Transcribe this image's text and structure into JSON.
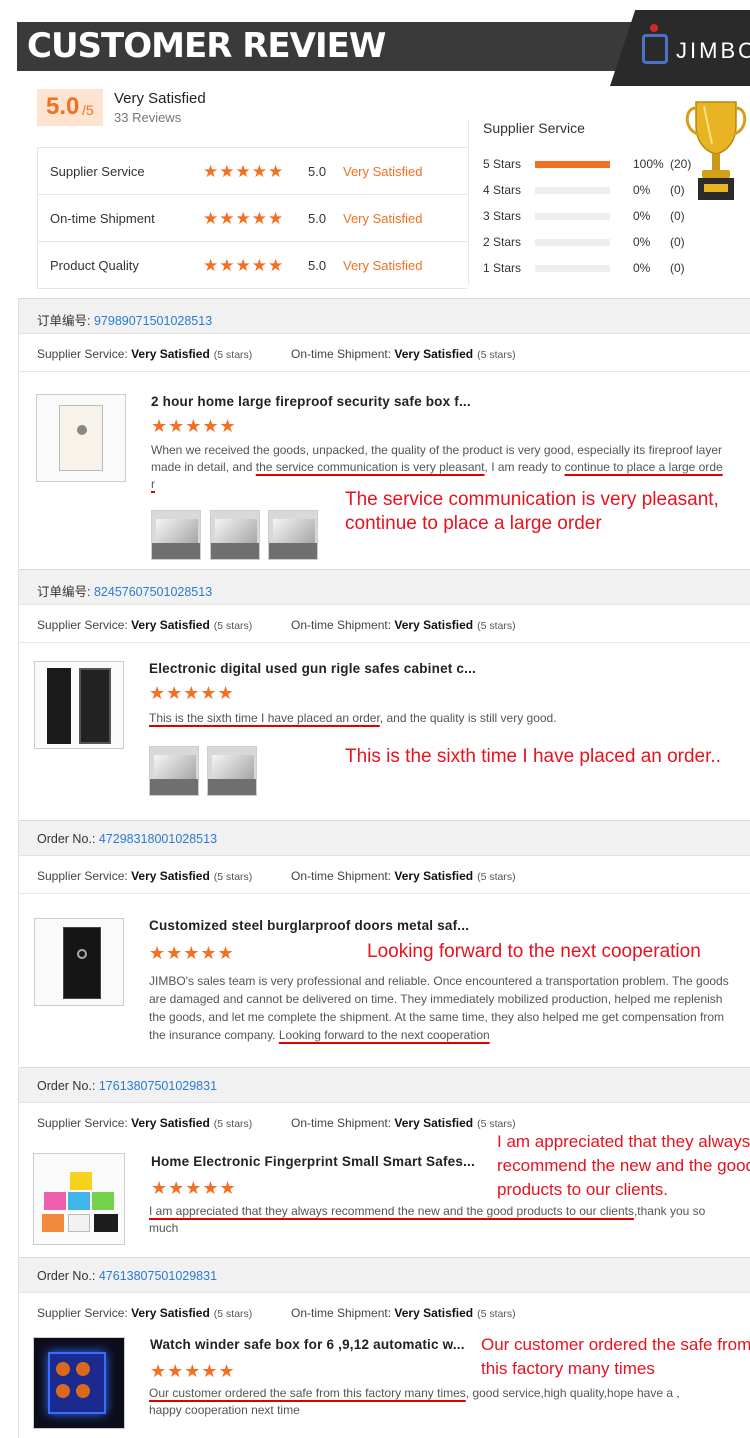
{
  "banner": {
    "title": "CUSTOMER REVIEW",
    "logo_text": "JIMBO"
  },
  "summary": {
    "score": "5.0",
    "score_max": "/5",
    "label": "Very Satisfied",
    "count": "33 Reviews"
  },
  "ratings": [
    {
      "label": "Supplier Service",
      "stars": "★★★★★",
      "score": "5.0",
      "text": "Very Satisfied"
    },
    {
      "label": "On-time Shipment",
      "stars": "★★★★★",
      "score": "5.0",
      "text": "Very Satisfied"
    },
    {
      "label": "Product Quality",
      "stars": "★★★★★",
      "score": "5.0",
      "text": "Very Satisfied"
    }
  ],
  "distribution": {
    "title": "Supplier Service",
    "rows": [
      {
        "label": "5 Stars",
        "fill": 1.0,
        "pct": "100%",
        "count": "(20)"
      },
      {
        "label": "4 Stars",
        "fill": 0,
        "pct": "0%",
        "count": "(0)"
      },
      {
        "label": "3 Stars",
        "fill": 0,
        "pct": "0%",
        "count": "(0)"
      },
      {
        "label": "2 Stars",
        "fill": 0,
        "pct": "0%",
        "count": "(0)"
      },
      {
        "label": "1 Stars",
        "fill": 0,
        "pct": "0%",
        "count": "(0)"
      }
    ]
  },
  "orders": [
    {
      "order_label": "订单编号:",
      "order_no": "97989071501028513",
      "svc_label": "Supplier Service:",
      "svc_value": "Very Satisfied",
      "svc_stars": "(5 stars)",
      "ship_label": "On-time Shipment:",
      "ship_value": "Very Satisfied",
      "ship_stars": "(5 stars)",
      "product_title": "2 hour home large fireproof security safe box f...",
      "stars": "★★★★★",
      "body_1": "When we received the goods, unpacked, the quality of the product is very good, especially its fireproof layer made in detail, and ",
      "body_u1": "the service communication is very pleasant",
      "body_2": ", I am ready to ",
      "body_u2": "continue to place a large orde",
      "body_3": "r",
      "annotation": "The service communication is very pleasant, continue to place a large order"
    },
    {
      "order_label": "订单编号:",
      "order_no": "82457607501028513",
      "svc_label": "Supplier Service:",
      "svc_value": "Very Satisfied",
      "svc_stars": "(5 stars)",
      "ship_label": "On-time Shipment:",
      "ship_value": "Very Satisfied",
      "ship_stars": "(5 stars)",
      "product_title": "Electronic digital used gun rigle safes cabinet c...",
      "stars": "★★★★★",
      "body_u1": "This is the sixth time I have placed an order",
      "body_2": ", and the quality is still very good.",
      "annotation": "This is the sixth time I have placed an order.."
    },
    {
      "order_label": "Order No.:",
      "order_no": "47298318001028513",
      "svc_label": "Supplier Service:",
      "svc_value": "Very Satisfied",
      "svc_stars": "(5 stars)",
      "ship_label": "On-time Shipment:",
      "ship_value": "Very Satisfied",
      "ship_stars": "(5 stars)",
      "product_title": "Customized steel burglarproof doors metal saf...",
      "stars": "★★★★★",
      "body_1": "JIMBO's sales team is very professional and reliable. Once encountered a transportation problem. The goods are damaged and cannot be delivered on time. They immediately mobilized production, helped me replenish the goods, and let me complete the shipment. At the same time, they also helped me get compensation from the insurance company. ",
      "body_u1": "Looking forward to the next cooperation",
      "annotation": "Looking forward to the next cooperation"
    },
    {
      "order_label": "Order No.:",
      "order_no": "17613807501029831",
      "svc_label": "Supplier Service:",
      "svc_value": "Very Satisfied",
      "svc_stars": "(5 stars)",
      "ship_label": "On-time Shipment:",
      "ship_value": "Very Satisfied",
      "ship_stars": "(5 stars)",
      "product_title": "Home Electronic Fingerprint Small Smart Safes...",
      "stars": "★★★★★",
      "body_u1": "I am appreciated that they always recommend the new and the good products to our clients",
      "body_2": ",thank you so much",
      "annotation": "I am appreciated that they always recommend the new and the good products to our clients."
    },
    {
      "order_label": "Order No.:",
      "order_no": "47613807501029831",
      "svc_label": "Supplier Service:",
      "svc_value": "Very Satisfied",
      "svc_stars": "(5 stars)",
      "ship_label": "On-time Shipment:",
      "ship_value": "Very Satisfied",
      "ship_stars": "(5 stars)",
      "product_title": "Watch winder safe box for 6 ,9,12 automatic w...",
      "stars": "★★★★★",
      "body_u1": "Our customer ordered the safe from this factory many times",
      "body_2": ", good service,high quality,hope have a , happy cooperation next time",
      "annotation": "Our customer ordered the safe from this factory many times"
    }
  ],
  "colors": {
    "accent": "#f36f21",
    "link": "#2a7bd3",
    "annotation": "#e8121f",
    "banner": "#3a3a3a"
  }
}
